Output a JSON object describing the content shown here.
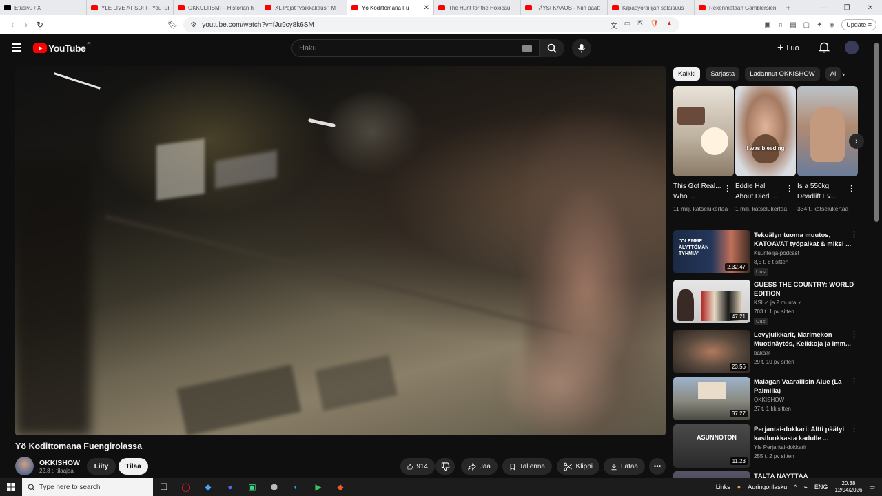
{
  "browser": {
    "tabs": [
      {
        "title": "Etusivu / X",
        "icon": "x-logo-icon",
        "active": false
      },
      {
        "title": "YLE LIVE AT SOFI - YouTube",
        "icon": "youtube-icon",
        "active": false
      },
      {
        "title": "OKKULTISMI – Historian h",
        "icon": "youtube-icon",
        "active": false
      },
      {
        "title": "XL Pojat \"vaikkakausi\" M",
        "icon": "youtube-icon",
        "active": false
      },
      {
        "title": "Yö Kodittomana Fu",
        "icon": "youtube-icon",
        "active": true
      },
      {
        "title": "The Hunt for the Holocau",
        "icon": "youtube-icon",
        "active": false
      },
      {
        "title": "TÄYSI KAAOS - Niin päätt",
        "icon": "youtube-icon",
        "active": false
      },
      {
        "title": "Kilpapyöräilijän salaisuus",
        "icon": "youtube-icon",
        "active": false
      },
      {
        "title": "Rekenmetaan Gämblersien",
        "icon": "youtube-icon",
        "active": false
      }
    ],
    "url": "youtube.com/watch?v=fJu9cy8k6SM",
    "update_label": "Update"
  },
  "youtube": {
    "logo_text": "YouTube",
    "country_code": "FI",
    "search_placeholder": "Haku",
    "create_label": "Luo"
  },
  "video": {
    "title": "Yö Kodittomana Fuengirolassa",
    "channel_name": "OKKISHOW",
    "subscribers": "22,8 t. tilaajaa",
    "join_label": "Liity",
    "subscribe_label": "Tilaa",
    "like_count": "914",
    "share_label": "Jaa",
    "save_label": "Tallenna",
    "clip_label": "Klippi",
    "download_label": "Lataa"
  },
  "chips": [
    "Kaikki",
    "Sarjasta",
    "Ladannut OKKISHOW",
    "Ai"
  ],
  "shorts": [
    {
      "title": "This Got Real... Who ...",
      "views": "11 milj. katselukertaa",
      "overlay": "",
      "bg": "#d9d2c8"
    },
    {
      "title": "Eddie Hall About Died ...",
      "views": "1 milj. katselukertaa",
      "overlay": "I was bleeding",
      "bg": "#8c6f5e"
    },
    {
      "title": "Is a 550kg Deadlift Ev...",
      "views": "334 t. katselukertaa",
      "overlay": "",
      "bg": "#9a8070"
    }
  ],
  "recommended": [
    {
      "title": "Tekoälyn tuoma muutos, KATOAVAT työpaikat & miksi ...",
      "channel": "Kuuntelija-podcast",
      "meta": "8,5 t.  8 t sitten",
      "badge": "Uusi",
      "duration": "2.32.47",
      "thumb_text": "\"OLEMME ÄLYTTÖMÄN TYHMIÄ\"",
      "bg": "#1b2a44"
    },
    {
      "title": "GUESS THE COUNTRY: WORLD EDITION",
      "channel": "KSI ✓ ja 2 muuta ✓",
      "meta": "703 t.  1 pv sitten",
      "badge": "Uusi",
      "duration": "47.21",
      "thumb_text": "",
      "bg": "#cfcfcf"
    },
    {
      "title": "Levyjulkkarit, Marimekon Muotinäytös, Keikkoja ja Imm...",
      "channel": "baka®",
      "meta": "29 t.  10 pv sitten",
      "badge": "",
      "duration": "23.56",
      "thumb_text": "",
      "bg": "#6a5a4a"
    },
    {
      "title": "Malagan Vaarallisin Alue (La Palmilla)",
      "channel": "OKKISHOW",
      "meta": "27 t.  1 kk sitten",
      "badge": "",
      "duration": "37.27",
      "thumb_text": "",
      "bg": "#8fa2b8"
    },
    {
      "title": "Perjantai-dokkari: Altti päätyi kasiluokkasta kadulle ...",
      "channel": "Yle Perjantai-dokkarit",
      "meta": "255 t.  2 pv sitten",
      "badge": "",
      "duration": "11.23",
      "thumb_text": "ASUNNOTON",
      "bg": "#333"
    },
    {
      "title": "TÄLTÄ NÄYTTÄÄ",
      "channel": "",
      "meta": "",
      "badge": "",
      "duration": "",
      "thumb_text": "",
      "bg": "#556"
    }
  ],
  "taskbar": {
    "search_placeholder": "Type here to search",
    "links_label": "Links",
    "weather": "Auringonlasku",
    "language": "ENG",
    "time": "20.38",
    "date": "12/04/2026"
  }
}
